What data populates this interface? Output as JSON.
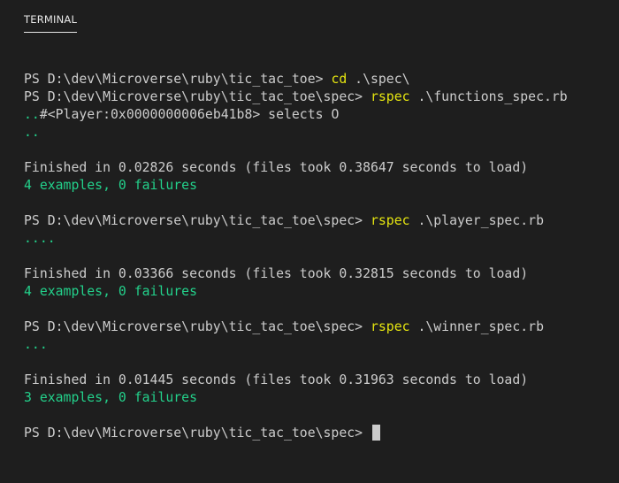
{
  "panel": {
    "tab_label": "TERMINAL"
  },
  "terminal": {
    "lines": [
      {
        "segments": [
          {
            "text": "PS D:\\dev\\Microverse\\ruby\\tic_tac_toe> ",
            "color": "default"
          },
          {
            "text": "cd",
            "color": "cmd"
          },
          {
            "text": " .\\spec\\",
            "color": "default"
          }
        ]
      },
      {
        "segments": [
          {
            "text": "PS D:\\dev\\Microverse\\ruby\\tic_tac_toe\\spec> ",
            "color": "default"
          },
          {
            "text": "rspec",
            "color": "cmd"
          },
          {
            "text": " .\\functions_spec.rb",
            "color": "default"
          }
        ]
      },
      {
        "segments": [
          {
            "text": "..",
            "color": "green"
          },
          {
            "text": "#<Player:0x0000000006eb41b8> selects O",
            "color": "default"
          }
        ]
      },
      {
        "segments": [
          {
            "text": "..",
            "color": "green"
          }
        ]
      },
      {
        "segments": []
      },
      {
        "segments": [
          {
            "text": "Finished in 0.02826 seconds (files took 0.38647 seconds to load)",
            "color": "default"
          }
        ]
      },
      {
        "segments": [
          {
            "text": "4 examples, 0 failures",
            "color": "green"
          }
        ]
      },
      {
        "segments": []
      },
      {
        "segments": [
          {
            "text": "PS D:\\dev\\Microverse\\ruby\\tic_tac_toe\\spec> ",
            "color": "default"
          },
          {
            "text": "rspec",
            "color": "cmd"
          },
          {
            "text": " .\\player_spec.rb",
            "color": "default"
          }
        ]
      },
      {
        "segments": [
          {
            "text": "....",
            "color": "green"
          }
        ]
      },
      {
        "segments": []
      },
      {
        "segments": [
          {
            "text": "Finished in 0.03366 seconds (files took 0.32815 seconds to load)",
            "color": "default"
          }
        ]
      },
      {
        "segments": [
          {
            "text": "4 examples, 0 failures",
            "color": "green"
          }
        ]
      },
      {
        "segments": []
      },
      {
        "segments": [
          {
            "text": "PS D:\\dev\\Microverse\\ruby\\tic_tac_toe\\spec> ",
            "color": "default"
          },
          {
            "text": "rspec",
            "color": "cmd"
          },
          {
            "text": " .\\winner_spec.rb",
            "color": "default"
          }
        ]
      },
      {
        "segments": [
          {
            "text": "...",
            "color": "green"
          }
        ]
      },
      {
        "segments": []
      },
      {
        "segments": [
          {
            "text": "Finished in 0.01445 seconds (files took 0.31963 seconds to load)",
            "color": "default"
          }
        ]
      },
      {
        "segments": [
          {
            "text": "3 examples, 0 failures",
            "color": "green"
          }
        ]
      },
      {
        "segments": []
      },
      {
        "segments": [
          {
            "text": "PS D:\\dev\\Microverse\\ruby\\tic_tac_toe\\spec> ",
            "color": "default"
          }
        ],
        "cursor": true
      }
    ]
  },
  "colors": {
    "background": "#1e1e1e",
    "default": "#cccccc",
    "cmd": "#e5e510",
    "green": "#23d18b"
  }
}
